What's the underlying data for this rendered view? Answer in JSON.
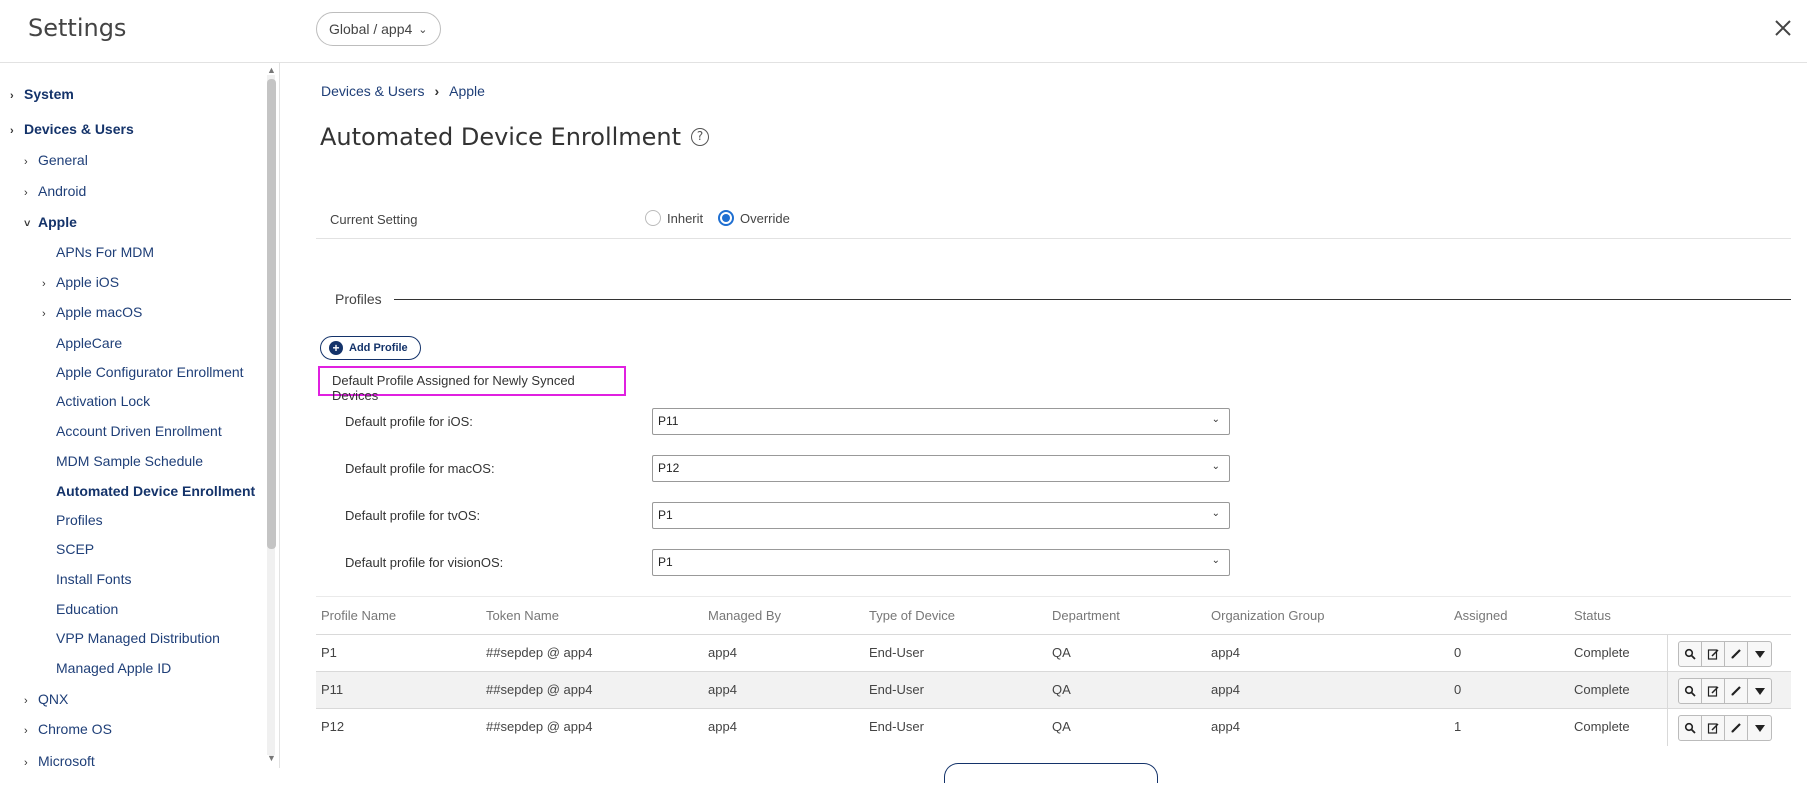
{
  "header": {
    "title": "Settings",
    "scope": "Global / app4"
  },
  "sidebar": {
    "items": [
      {
        "label": "System",
        "caret": "›",
        "level": 0,
        "bold": true
      },
      {
        "label": "Devices & Users",
        "caret": "›",
        "level": 0,
        "bold": true
      },
      {
        "label": "General",
        "caret": "›",
        "level": 1
      },
      {
        "label": "Android",
        "caret": "›",
        "level": 1
      },
      {
        "label": "Apple",
        "caret": "˅",
        "level": 1,
        "bold": true
      },
      {
        "label": "APNs For MDM",
        "caret": "",
        "level": 2
      },
      {
        "label": "Apple iOS",
        "caret": "›",
        "level": 2
      },
      {
        "label": "Apple macOS",
        "caret": "›",
        "level": 2
      },
      {
        "label": "AppleCare",
        "caret": "",
        "level": 2
      },
      {
        "label": "Apple Configurator Enrollment",
        "caret": "",
        "level": 2
      },
      {
        "label": "Activation Lock",
        "caret": "",
        "level": 2
      },
      {
        "label": "Account Driven Enrollment",
        "caret": "",
        "level": 2
      },
      {
        "label": "MDM Sample Schedule",
        "caret": "",
        "level": 2
      },
      {
        "label": "Automated Device Enrollment",
        "caret": "",
        "level": 2,
        "bold": true
      },
      {
        "label": "Profiles",
        "caret": "",
        "level": 2
      },
      {
        "label": "SCEP",
        "caret": "",
        "level": 2
      },
      {
        "label": "Install Fonts",
        "caret": "",
        "level": 2
      },
      {
        "label": "Education",
        "caret": "",
        "level": 2
      },
      {
        "label": "VPP Managed Distribution",
        "caret": "",
        "level": 2
      },
      {
        "label": "Managed Apple ID",
        "caret": "",
        "level": 2
      },
      {
        "label": "QNX",
        "caret": "›",
        "level": 1
      },
      {
        "label": "Chrome OS",
        "caret": "›",
        "level": 1
      },
      {
        "label": "Microsoft",
        "caret": "›",
        "level": 1
      }
    ]
  },
  "breadcrumb": {
    "items": [
      "Devices & Users",
      "Apple"
    ],
    "separator": "›"
  },
  "page": {
    "title": "Automated Device Enrollment",
    "help": "?"
  },
  "current_setting": {
    "label": "Current Setting",
    "options": [
      "Inherit",
      "Override"
    ],
    "selected": "Override"
  },
  "profiles_section": {
    "title": "Profiles",
    "add_button": "Add Profile",
    "default_header": "Default Profile Assigned for Newly Synced Devices",
    "defaults": [
      {
        "label": "Default profile for iOS:",
        "value": "P11"
      },
      {
        "label": "Default profile for macOS:",
        "value": "P12"
      },
      {
        "label": "Default profile for tvOS:",
        "value": "P1"
      },
      {
        "label": "Default profile for visionOS:",
        "value": "P1"
      }
    ]
  },
  "table": {
    "columns": [
      "Profile Name",
      "Token Name",
      "Managed By",
      "Type of Device",
      "Department",
      "Organization Group",
      "Assigned",
      "Status"
    ],
    "rows": [
      [
        "P1",
        "##sepdep @ app4",
        "app4",
        "End-User",
        "QA",
        "app4",
        "0",
        "Complete"
      ],
      [
        "P11",
        "##sepdep @ app4",
        "app4",
        "End-User",
        "QA",
        "app4",
        "0",
        "Complete"
      ],
      [
        "P12",
        "##sepdep @ app4",
        "app4",
        "End-User",
        "QA",
        "app4",
        "1",
        "Complete"
      ]
    ]
  },
  "colors": {
    "brand": "#14336a",
    "link": "#1f3f78",
    "radio": "#1f6fd1",
    "highlight": "#e020e0"
  }
}
